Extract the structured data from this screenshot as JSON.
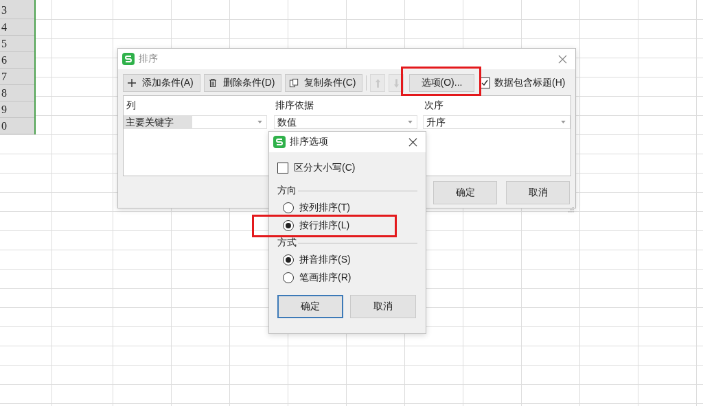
{
  "sheet": {
    "row_headers": [
      "3",
      "4",
      "5",
      "6",
      "7",
      "8",
      "9",
      "0"
    ]
  },
  "sort_dialog": {
    "title": "排序",
    "toolbar": [
      {
        "kind": "add",
        "label": "添加条件(A)",
        "disabled": false
      },
      {
        "kind": "delete",
        "label": "删除条件(D)",
        "disabled": false
      },
      {
        "kind": "copy",
        "label": "复制条件(C)",
        "disabled": false
      },
      {
        "kind": "up",
        "disabled": true
      },
      {
        "kind": "down",
        "disabled": true
      },
      {
        "kind": "options",
        "label": "选项(O)...",
        "disabled": false,
        "highlighted": true
      }
    ],
    "header_checkbox": {
      "label": "数据包含标题(H)",
      "checked": true
    },
    "columns": [
      "列",
      "排序依据",
      "次序"
    ],
    "rows": [
      {
        "label": "主要关键字",
        "basis": "数值",
        "order": "升序"
      }
    ],
    "buttons": [
      "确定",
      "取消"
    ]
  },
  "options_dialog": {
    "title": "排序选项",
    "case_sensitive": {
      "label": "区分大小写(C)",
      "checked": false
    },
    "groups": [
      {
        "title": "方向",
        "options": [
          {
            "label": "按列排序(T)",
            "selected": false,
            "highlighted": false
          },
          {
            "label": "按行排序(L)",
            "selected": true,
            "highlighted": true
          }
        ]
      },
      {
        "title": "方式",
        "options": [
          {
            "label": "拼音排序(S)",
            "selected": true,
            "highlighted": false
          },
          {
            "label": "笔画排序(R)",
            "selected": false,
            "highlighted": false
          }
        ]
      }
    ],
    "buttons": [
      {
        "label": "确定",
        "default": true
      },
      {
        "label": "取消",
        "default": false
      }
    ]
  }
}
